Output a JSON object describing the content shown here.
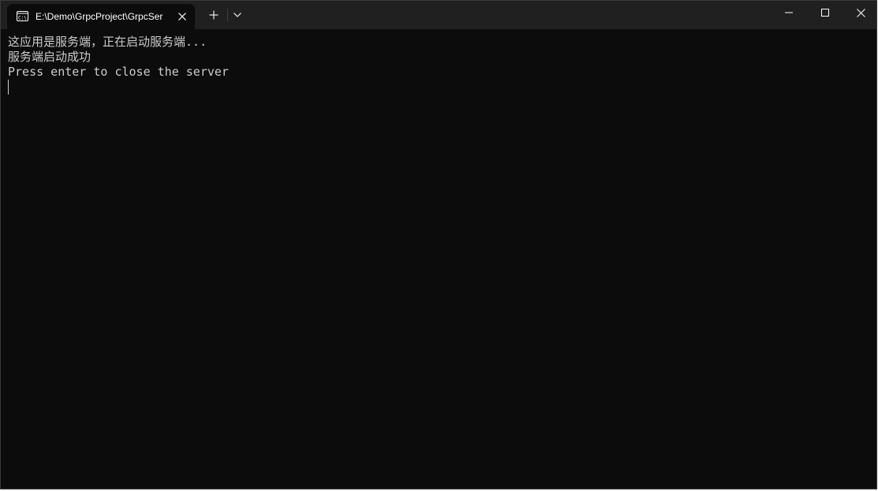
{
  "window": {
    "tab_title": "E:\\Demo\\GrpcProject\\GrpcSer",
    "icons": {
      "tab": "terminal-icon",
      "close_tab": "close-icon",
      "new_tab": "plus-icon",
      "dropdown": "chevron-down-icon",
      "minimize": "minimize-icon",
      "maximize": "maximize-icon",
      "close_window": "close-icon"
    }
  },
  "console": {
    "lines": [
      "这应用是服务端，正在启动服务端...",
      "服务端启动成功",
      "Press enter to close the server"
    ]
  },
  "colors": {
    "background": "#0c0c0c",
    "titlebar": "#202020",
    "text": "#cccccc"
  }
}
